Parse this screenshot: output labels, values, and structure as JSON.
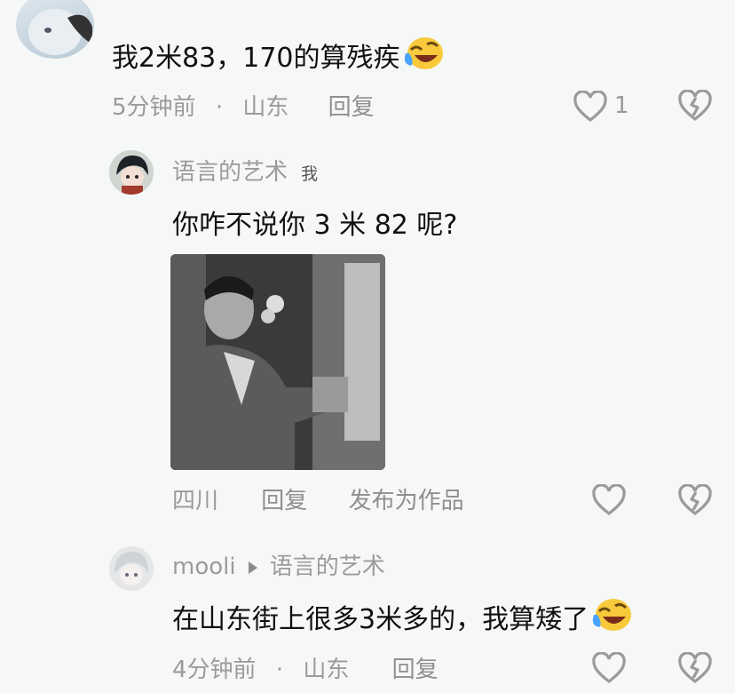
{
  "comments": [
    {
      "text": "我2米83，170的算残疾",
      "emoji": "laugh-cry",
      "time": "5分钟前",
      "dot": "·",
      "location": "山东",
      "reply_label": "回复",
      "like_count": "1"
    }
  ],
  "reply1": {
    "username": "语言的艺术",
    "badge": "我",
    "text": "你咋不说你 3 米 82 呢?",
    "location": "四川",
    "reply_label": "回复",
    "publish_label": "发布为作品"
  },
  "reply2": {
    "username": "mooli",
    "reply_to": "语言的艺术",
    "text": "在山东街上很多3米多的，我算矮了",
    "emoji": "laugh-cry",
    "time": "4分钟前",
    "dot": "·",
    "location": "山东",
    "reply_label": "回复"
  },
  "colors": {
    "text": "#111111",
    "meta": "#9a9a9a",
    "background": "#f6f8f7",
    "emoji_face": "#f8c93a"
  }
}
